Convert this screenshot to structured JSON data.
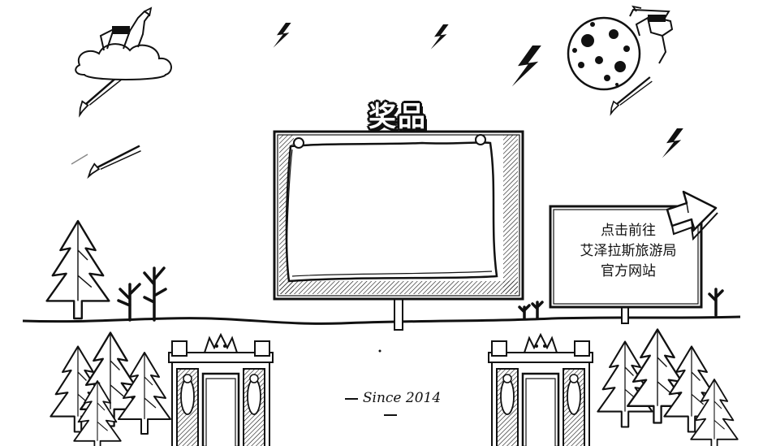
{
  "prize_board": {
    "title": "奖品"
  },
  "tourism_link": {
    "line1": "点击前往",
    "line2": "艾泽拉斯旅游局",
    "line3": "官方网站"
  },
  "footer": {
    "since": "Since 2014"
  },
  "colors": {
    "ink": "#111111",
    "paper": "#ffffff"
  }
}
